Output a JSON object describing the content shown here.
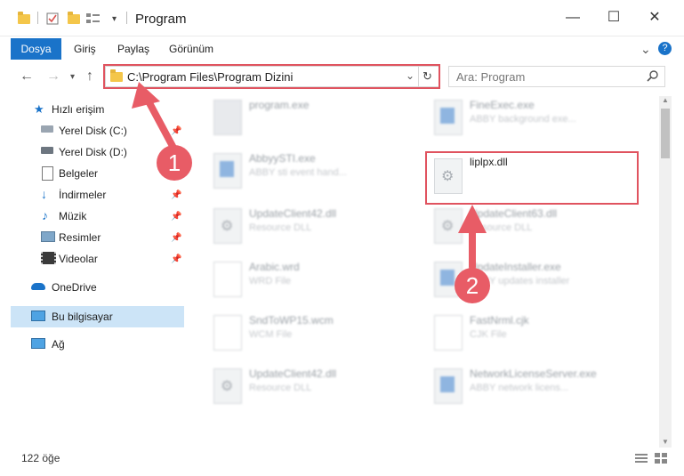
{
  "title_bar": {
    "title": "Program",
    "minimize": "—",
    "maximize": "☐",
    "close": "✕"
  },
  "ribbon": {
    "tabs": [
      "Dosya",
      "Giriş",
      "Paylaş",
      "Görünüm"
    ],
    "expand": "⌄",
    "help": "?"
  },
  "address": {
    "path": "C:\\Program Files\\Program Dizini",
    "search_placeholder": "Ara: Program"
  },
  "nav_items": [
    {
      "label": "Hızlı erişim",
      "icon": "star-icon"
    },
    {
      "label": "Yerel Disk (C:)",
      "icon": "drive-icon",
      "pinned": true
    },
    {
      "label": "Yerel Disk (D:)",
      "icon": "drive-icon",
      "pinned": false
    },
    {
      "label": "Belgeler",
      "icon": "document-icon",
      "pinned": true
    },
    {
      "label": "İndirmeler",
      "icon": "download-icon",
      "pinned": true
    },
    {
      "label": "Müzik",
      "icon": "music-icon",
      "pinned": true
    },
    {
      "label": "Resimler",
      "icon": "image-icon",
      "pinned": true
    },
    {
      "label": "Videolar",
      "icon": "video-icon",
      "pinned": true
    },
    {
      "label": "OneDrive",
      "icon": "cloud-icon"
    },
    {
      "label": "Bu bilgisayar",
      "icon": "computer-icon",
      "selected": true
    },
    {
      "label": "Ağ",
      "icon": "network-icon"
    }
  ],
  "files": [
    {
      "name": "program.exe",
      "desc": ""
    },
    {
      "name": "FineExec.exe",
      "desc": "ABBY background exe..."
    },
    {
      "name": "AbbyySTI.exe",
      "desc": "ABBY sti event hand..."
    },
    {
      "name": "liplpx.dll",
      "desc": ""
    },
    {
      "name": "UpdateClient42.dll",
      "desc": "Resource DLL"
    },
    {
      "name": "UpdateClient63.dll",
      "desc": "Resource DLL"
    },
    {
      "name": "Arabic.wrd",
      "desc": "WRD File"
    },
    {
      "name": "UpdateInstaller.exe",
      "desc": "ABBY updates installer"
    },
    {
      "name": "SndToWP15.wcm",
      "desc": "WCM File"
    },
    {
      "name": "FastNrml.cjk",
      "desc": "CJK File"
    },
    {
      "name": "UpdateClient42.dll",
      "desc": "Resource DLL"
    },
    {
      "name": "NetworkLicenseServer.exe",
      "desc": "ABBY network licens..."
    }
  ],
  "status": {
    "count": "122 öğe"
  },
  "annotations": {
    "badge1": "1",
    "badge2": "2"
  },
  "colors": {
    "accent": "#1a73c9",
    "highlight": "#e0535f",
    "badge": "#e85c66"
  }
}
